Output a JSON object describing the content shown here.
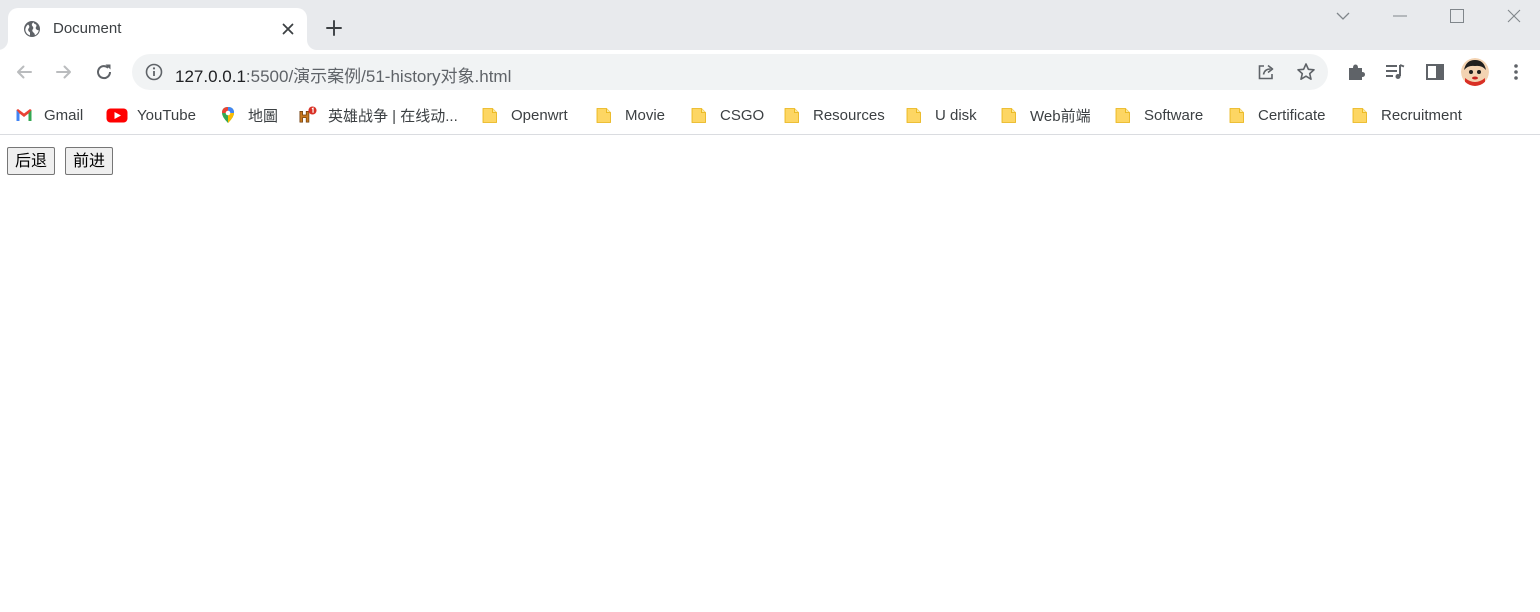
{
  "tab": {
    "title": "Document",
    "favicon": "globe-icon"
  },
  "window_controls": [
    "tab-search-icon",
    "minimize-icon",
    "maximize-icon",
    "close-icon"
  ],
  "address_bar": {
    "url_host": "127.0.0.1",
    "url_rest": ":5500/演示案例/51-history对象.html"
  },
  "bookmarks": [
    {
      "label": "Gmail",
      "icon": "gmail-icon"
    },
    {
      "label": "YouTube",
      "icon": "youtube-icon"
    },
    {
      "label": "地圖",
      "icon": "maps-icon"
    },
    {
      "label": "英雄战争 | 在线动...",
      "icon": "game-icon"
    },
    {
      "label": "Openwrt",
      "icon": "folder-icon"
    },
    {
      "label": "Movie",
      "icon": "folder-icon"
    },
    {
      "label": "CSGO",
      "icon": "folder-icon"
    },
    {
      "label": "Resources",
      "icon": "folder-icon"
    },
    {
      "label": "U disk",
      "icon": "folder-icon"
    },
    {
      "label": "Web前端",
      "icon": "folder-icon"
    },
    {
      "label": "Software",
      "icon": "folder-icon"
    },
    {
      "label": "Certificate",
      "icon": "folder-icon"
    },
    {
      "label": "Recruitment",
      "icon": "folder-icon"
    }
  ],
  "page": {
    "back_button": "后退",
    "forward_button": "前进"
  },
  "colors": {
    "tabstrip": "#e8eaed",
    "omnibox": "#f1f3f4",
    "folder": "#fdd663"
  }
}
